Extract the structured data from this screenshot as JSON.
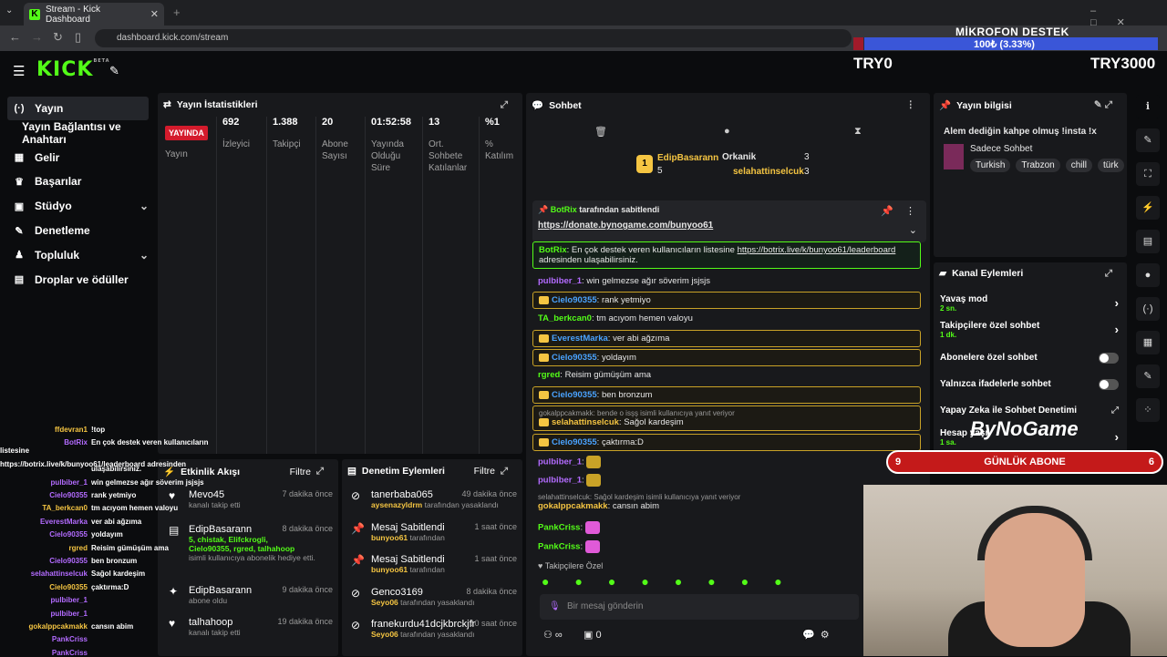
{
  "browser": {
    "tab_title": "Stream - Kick Dashboard",
    "url": "dashboard.kick.com/stream"
  },
  "logo": {
    "text": "KICK",
    "beta": "BETA"
  },
  "overlay": {
    "goal_title": "MİKROFON DESTEK",
    "goal_value": "100₺ (3.33%)",
    "goal_fraction": 0.0333,
    "try_left": "TRY0",
    "try_right": "TRY3000",
    "daily_label": "GÜNLÜK ABONE",
    "daily_left": "9",
    "daily_right": "6",
    "brand": "ByNoGame"
  },
  "sidebar": {
    "items": [
      {
        "label": "Yayın",
        "icon": "broadcast-icon",
        "active": true
      },
      {
        "label": "Yayın Bağlantısı ve Anahtarı",
        "icon": ""
      },
      {
        "label": "Gelir",
        "icon": "revenue-icon"
      },
      {
        "label": "Başarılar",
        "icon": "trophy-icon"
      },
      {
        "label": "Stüdyo",
        "icon": "studio-icon",
        "chevron": true
      },
      {
        "label": "Denetleme",
        "icon": "wrench-icon"
      },
      {
        "label": "Topluluk",
        "icon": "community-icon",
        "chevron": true
      },
      {
        "label": "Droplar ve ödüller",
        "icon": "gift-icon"
      }
    ]
  },
  "stats": {
    "title": "Yayın İstatistikleri",
    "live": "YAYINDA",
    "live_label": "Yayın",
    "cols": [
      {
        "value": "692",
        "label": "İzleyici"
      },
      {
        "value": "1.388",
        "label": "Takipçi"
      },
      {
        "value": "20",
        "label": "Abone Sayısı"
      },
      {
        "value": "01:52:58",
        "label": "Yayında Olduğu Süre"
      },
      {
        "value": "13",
        "label": "Ort. Sohbete Katılanlar"
      },
      {
        "value": "%1",
        "label": "% Katılım"
      }
    ]
  },
  "activity": {
    "title": "Etkinlik Akışı",
    "filter": "Filtre",
    "items": [
      {
        "user": "Mevo45",
        "sub": "kanalı takip etti",
        "time": "7 dakika önce"
      },
      {
        "user": "EdipBasarann",
        "extra": "5, chistak, Elifckrogli, Cielo90355, rgred, talhahoop",
        "sub": "isimli kullanıcıya abonelik hediye etti.",
        "time": "8 dakika önce"
      },
      {
        "user": "EdipBasarann",
        "sub": "abone oldu",
        "time": "9 dakika önce"
      },
      {
        "user": "talhahoop",
        "sub": "kanalı takip etti",
        "time": "19 dakika önce"
      }
    ]
  },
  "modactions": {
    "title": "Denetim Eylemleri",
    "filter": "Filtre",
    "items": [
      {
        "user": "tanerbaba065",
        "by": "aysenazyldrm",
        "sub": "tarafından yasaklandı",
        "time": "49 dakika önce"
      },
      {
        "user": "Mesaj Sabitlendi",
        "by": "bunyoo61",
        "sub": "tarafından",
        "time": "1 saat önce"
      },
      {
        "user": "Mesaj Sabitlendi",
        "by": "bunyoo61",
        "sub": "tarafından",
        "time": "1 saat önce"
      },
      {
        "user": "Genco3169",
        "by": "Seyo06",
        "sub": "tarafından yasaklandı",
        "time": "8 dakika önce"
      },
      {
        "user": "franekurdu41dcjkbrckjfr",
        "by": "Seyo06",
        "sub": "tarafından yasaklandı",
        "time": "10 saat önce"
      }
    ]
  },
  "chat": {
    "title": "Sohbet",
    "top": {
      "first": "EdipBasarann",
      "first_count": "5",
      "u2": "Orkanik",
      "u2c": "3",
      "u3": "selahattinselcuk",
      "u3c": "3"
    },
    "pinned": {
      "by": "BotRix",
      "by_suffix": "tarafından sabitlendi",
      "link": "https://donate.bynogame.com/bunyoo61"
    },
    "messages": [
      {
        "user": "BotRix",
        "text": "En çok destek veren kullanıcıların listesine ",
        "link": "https://botrix.live/k/bunyoo61/leaderboard",
        "text2": " adresinden ulaşabilirsiniz.",
        "color": "green"
      },
      {
        "user": "pulbiber_1",
        "text": "win gelmezse ağır söverim jsjsjs",
        "color": "purple"
      },
      {
        "user": "Cielo90355",
        "text": "rank yetmiyo",
        "color": "blue",
        "gold": true
      },
      {
        "user": "TA_berkcan0",
        "text": "tm acıyom hemen valoyu",
        "color": "green"
      },
      {
        "user": "EverestMarka",
        "text": "ver abi ağzıma",
        "color": "blue",
        "gold": true
      },
      {
        "user": "Cielo90355",
        "text": "yoldayım",
        "color": "blue",
        "gold": true
      },
      {
        "user": "rgred",
        "text": "Reisim gümüşüm ama",
        "color": "green"
      },
      {
        "user": "Cielo90355",
        "text": "ben bronzum",
        "color": "blue",
        "gold": true
      },
      {
        "user": "selahattinselcuk",
        "reply": "gokalppcakmakk: bende o isşş isimli kullanıcıya yanıt veriyor",
        "text": "Sağol kardeşim",
        "color": "gold",
        "gold": true
      },
      {
        "user": "Cielo90355",
        "text": "çaktırma:D",
        "color": "blue",
        "gold": true
      },
      {
        "user": "pulbiber_1",
        "text": "",
        "color": "purple"
      },
      {
        "user": "pulbiber_1",
        "text": "",
        "color": "purple"
      },
      {
        "user": "gokalppcakmakk",
        "reply": "selahattinselcuk: Sağol kardeşim isimli kullanıcıya yanıt veriyor",
        "text": "cansın abim",
        "color": "gold"
      },
      {
        "user": "PankCriss",
        "text": "",
        "color": "green"
      },
      {
        "user": "PankCriss",
        "text": "",
        "color": "green"
      }
    ],
    "followers_only": "Takipçilere Özel",
    "placeholder": "Bir mesaj gönderin",
    "bottom_infinity": "∞",
    "bottom_count": "0"
  },
  "streaminfo": {
    "title": "Yayın bilgisi",
    "stream_title": "Alem dediğin kahpe olmuş !insta !x",
    "category": "Sadece Sohbet",
    "tags": [
      "Turkish",
      "Trabzon",
      "chill",
      "türk"
    ]
  },
  "channel": {
    "title": "Kanal Eylemleri",
    "items": [
      {
        "label": "Yavaş mod",
        "sub": "2 sn.",
        "type": "chevron"
      },
      {
        "label": "Takipçilere özel sohbet",
        "sub": "1 dk.",
        "type": "chevron"
      },
      {
        "label": "Abonelere özel sohbet",
        "type": "toggle"
      },
      {
        "label": "Yalnızca ifadelerle sohbet",
        "type": "toggle"
      },
      {
        "label": "Yapay Zeka ile Sohbet Denetimi",
        "type": "link"
      },
      {
        "label": "Hesap yaşı",
        "sub": "1 sa.",
        "type": "chevron"
      }
    ]
  },
  "overlay_chat": [
    {
      "n": "ffdevran1",
      "t": "!top"
    },
    {
      "n": "BotRix",
      "t": "En çok destek veren kullanıcıların listesine"
    },
    {
      "n": "",
      "t": "https://botrix.live/k/bunyoo61/leaderboard adresinden"
    },
    {
      "n": "",
      "t": "ulaşabilirsiniz."
    },
    {
      "n": "pulbiber_1",
      "t": "win gelmezse ağır söverim jsjsjs"
    },
    {
      "n": "Cielo90355",
      "t": "rank yetmiyo"
    },
    {
      "n": "TA_berkcan0",
      "t": "tm acıyom hemen valoyu"
    },
    {
      "n": "EverestMarka",
      "t": "ver abi ağzıma"
    },
    {
      "n": "Cielo90355",
      "t": "yoldayım"
    },
    {
      "n": "rgred",
      "t": "Reisim gümüşüm ama"
    },
    {
      "n": "Cielo90355",
      "t": "ben bronzum"
    },
    {
      "n": "selahattinselcuk",
      "t": "Sağol kardeşim"
    },
    {
      "n": "Cielo90355",
      "t": "çaktırma:D"
    },
    {
      "n": "pulbiber_1",
      "t": ""
    },
    {
      "n": "pulbiber_1",
      "t": ""
    },
    {
      "n": "gokalppcakmakk",
      "t": "cansın abim"
    },
    {
      "n": "PankCriss",
      "t": ""
    },
    {
      "n": "PankCriss",
      "t": ""
    }
  ]
}
